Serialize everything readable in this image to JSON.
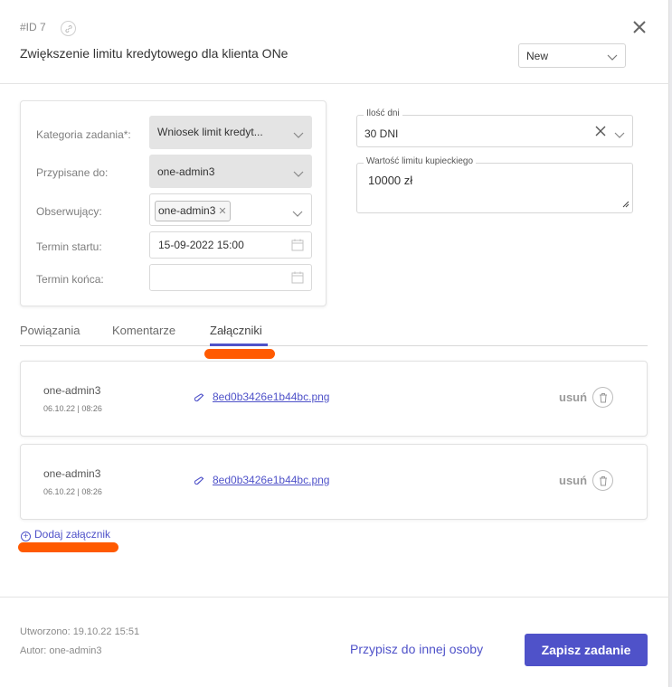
{
  "header": {
    "task_id": "#ID 7",
    "title": "Zwiększenie limitu kredytowego dla klienta ONe",
    "status": "New"
  },
  "fields": {
    "category_label": "Kategoria zadania*:",
    "category_value": "Wniosek limit kredyt...",
    "assigned_label": "Przypisane do:",
    "assigned_value": "one-admin3",
    "observers_label": "Obserwujący:",
    "observer_tag": "one-admin3",
    "start_label": "Termin startu:",
    "start_value": "15-09-2022 15:00",
    "end_label": "Termin końca:",
    "end_value": ""
  },
  "custom_fields": {
    "days_label": "Ilość dni",
    "days_value": "30 DNI",
    "limit_label": "Wartość limitu kupieckiego",
    "limit_value": "10000 zł"
  },
  "tabs": [
    {
      "label": "Powiązania"
    },
    {
      "label": "Komentarze"
    },
    {
      "label": "Załączniki",
      "active": true
    }
  ],
  "attachments": [
    {
      "author": "one-admin3",
      "date": "06.10.22 | 08:26",
      "file": "8ed0b3426e1b44bc.png",
      "remove": "usuń"
    },
    {
      "author": "one-admin3",
      "date": "06.10.22 | 08:26",
      "file": "8ed0b3426e1b44bc.png",
      "remove": "usuń"
    }
  ],
  "add_attachment": "Dodaj załącznik",
  "footer": {
    "created": "Utworzono: 19.10.22 15:51",
    "author": "Autor: one-admin3",
    "assign_label": "Przypisz do innej osoby",
    "save_label": "Zapisz zadanie"
  },
  "colors": {
    "accent": "#4f52c9",
    "highlight": "#ff5a00"
  }
}
